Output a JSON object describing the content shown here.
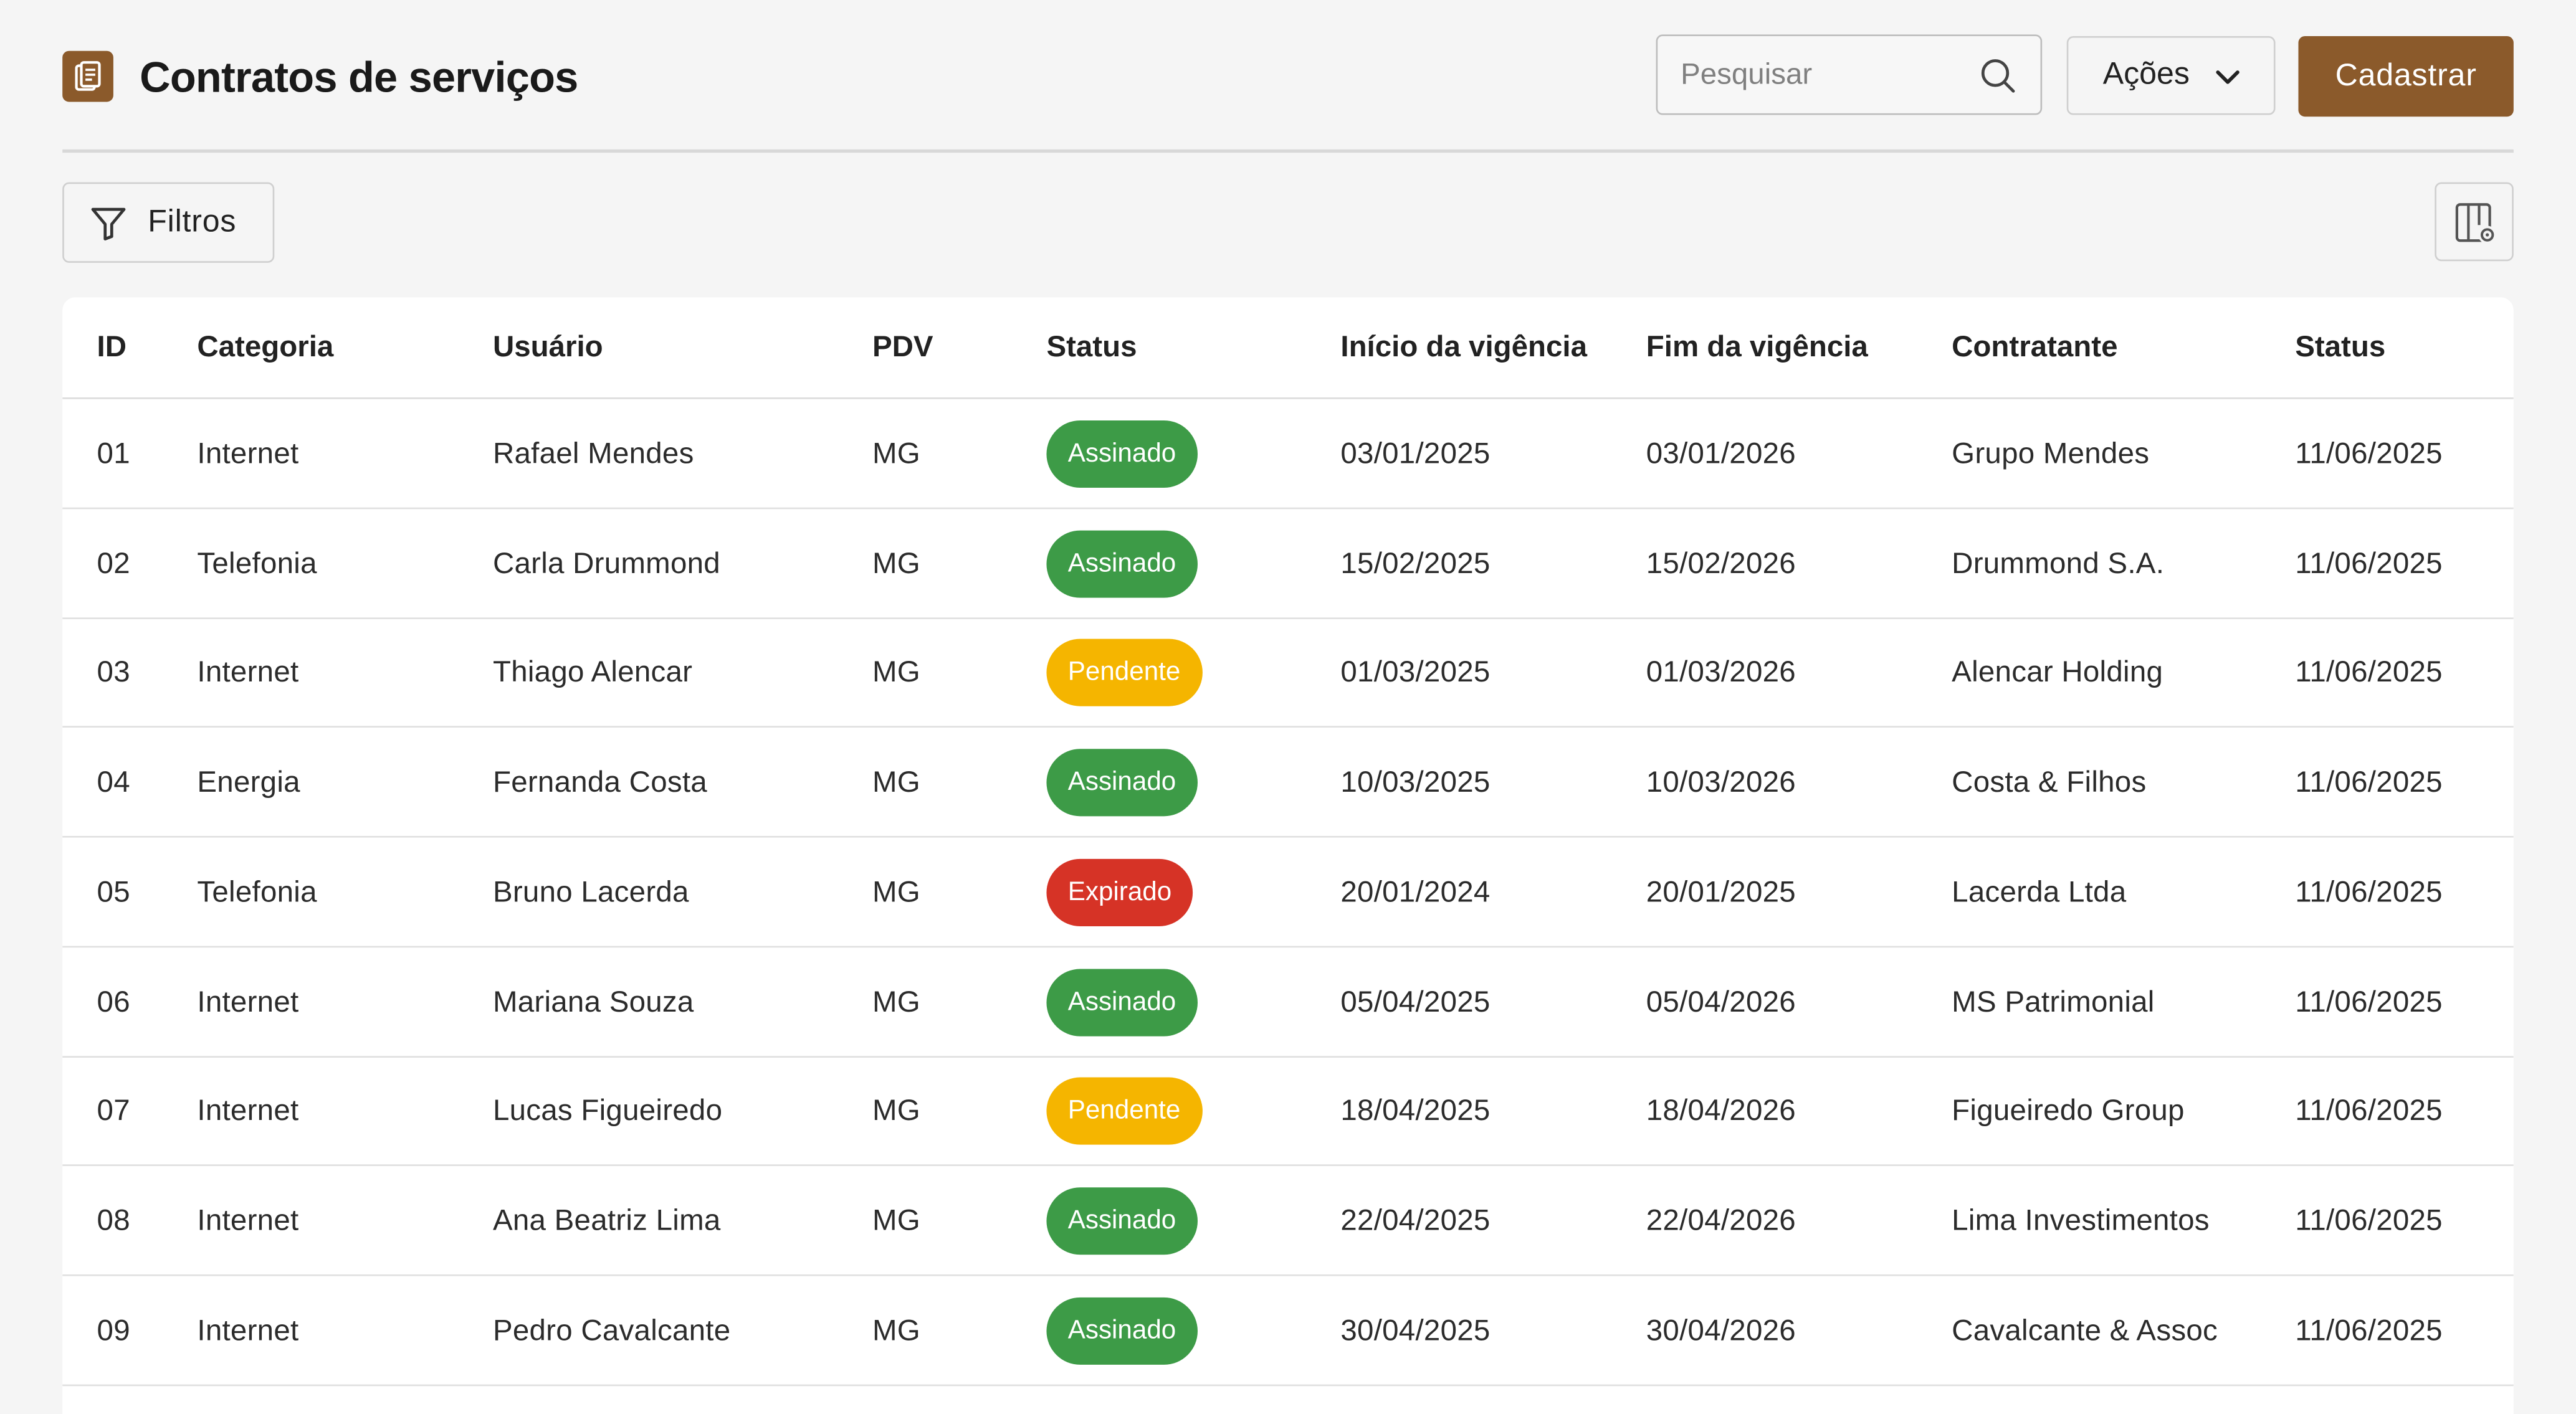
{
  "header": {
    "title": "Contratos de serviços",
    "search_placeholder": "Pesquisar",
    "actions_label": "Ações",
    "register_label": "Cadastrar"
  },
  "toolbar": {
    "filters_label": "Filtros"
  },
  "colors": {
    "brand": "#8b5a2b",
    "status_signed": "#3d9b47",
    "status_pending": "#f5b500",
    "status_expired": "#d63326"
  },
  "table": {
    "columns": [
      "ID",
      "Categoria",
      "Usuário",
      "PDV",
      "Status",
      "Início da vigência",
      "Fim da vigência",
      "Contratante",
      "Status"
    ],
    "rows": [
      {
        "id": "01",
        "categoria": "Internet",
        "usuario": "Rafael Mendes",
        "pdv": "MG",
        "status": "Assinado",
        "status_kind": "signed",
        "inicio": "03/01/2025",
        "fim": "03/01/2026",
        "contratante": "Grupo Mendes",
        "data": "11/06/2025"
      },
      {
        "id": "02",
        "categoria": "Telefonia",
        "usuario": "Carla Drummond",
        "pdv": "MG",
        "status": "Assinado",
        "status_kind": "signed",
        "inicio": "15/02/2025",
        "fim": "15/02/2026",
        "contratante": "Drummond S.A.",
        "data": "11/06/2025"
      },
      {
        "id": "03",
        "categoria": "Internet",
        "usuario": "Thiago Alencar",
        "pdv": "MG",
        "status": "Pendente",
        "status_kind": "pending",
        "inicio": "01/03/2025",
        "fim": "01/03/2026",
        "contratante": "Alencar Holding",
        "data": "11/06/2025"
      },
      {
        "id": "04",
        "categoria": "Energia",
        "usuario": "Fernanda Costa",
        "pdv": "MG",
        "status": "Assinado",
        "status_kind": "signed",
        "inicio": "10/03/2025",
        "fim": "10/03/2026",
        "contratante": "Costa & Filhos",
        "data": "11/06/2025"
      },
      {
        "id": "05",
        "categoria": "Telefonia",
        "usuario": "Bruno Lacerda",
        "pdv": "MG",
        "status": "Expirado",
        "status_kind": "expired",
        "inicio": "20/01/2024",
        "fim": "20/01/2025",
        "contratante": "Lacerda Ltda",
        "data": "11/06/2025"
      },
      {
        "id": "06",
        "categoria": "Internet",
        "usuario": "Mariana Souza",
        "pdv": "MG",
        "status": "Assinado",
        "status_kind": "signed",
        "inicio": "05/04/2025",
        "fim": "05/04/2026",
        "contratante": "MS Patrimonial",
        "data": "11/06/2025"
      },
      {
        "id": "07",
        "categoria": "Internet",
        "usuario": "Lucas Figueiredo",
        "pdv": "MG",
        "status": "Pendente",
        "status_kind": "pending",
        "inicio": "18/04/2025",
        "fim": "18/04/2026",
        "contratante": "Figueiredo Group",
        "data": "11/06/2025"
      },
      {
        "id": "08",
        "categoria": "Internet",
        "usuario": "Ana Beatriz Lima",
        "pdv": "MG",
        "status": "Assinado",
        "status_kind": "signed",
        "inicio": "22/04/2025",
        "fim": "22/04/2026",
        "contratante": "Lima Investimentos",
        "data": "11/06/2025"
      },
      {
        "id": "09",
        "categoria": "Internet",
        "usuario": "Pedro Cavalcante",
        "pdv": "MG",
        "status": "Assinado",
        "status_kind": "signed",
        "inicio": "30/04/2025",
        "fim": "30/04/2026",
        "contratante": "Cavalcante & Assoc",
        "data": "11/06/2025"
      }
    ]
  }
}
